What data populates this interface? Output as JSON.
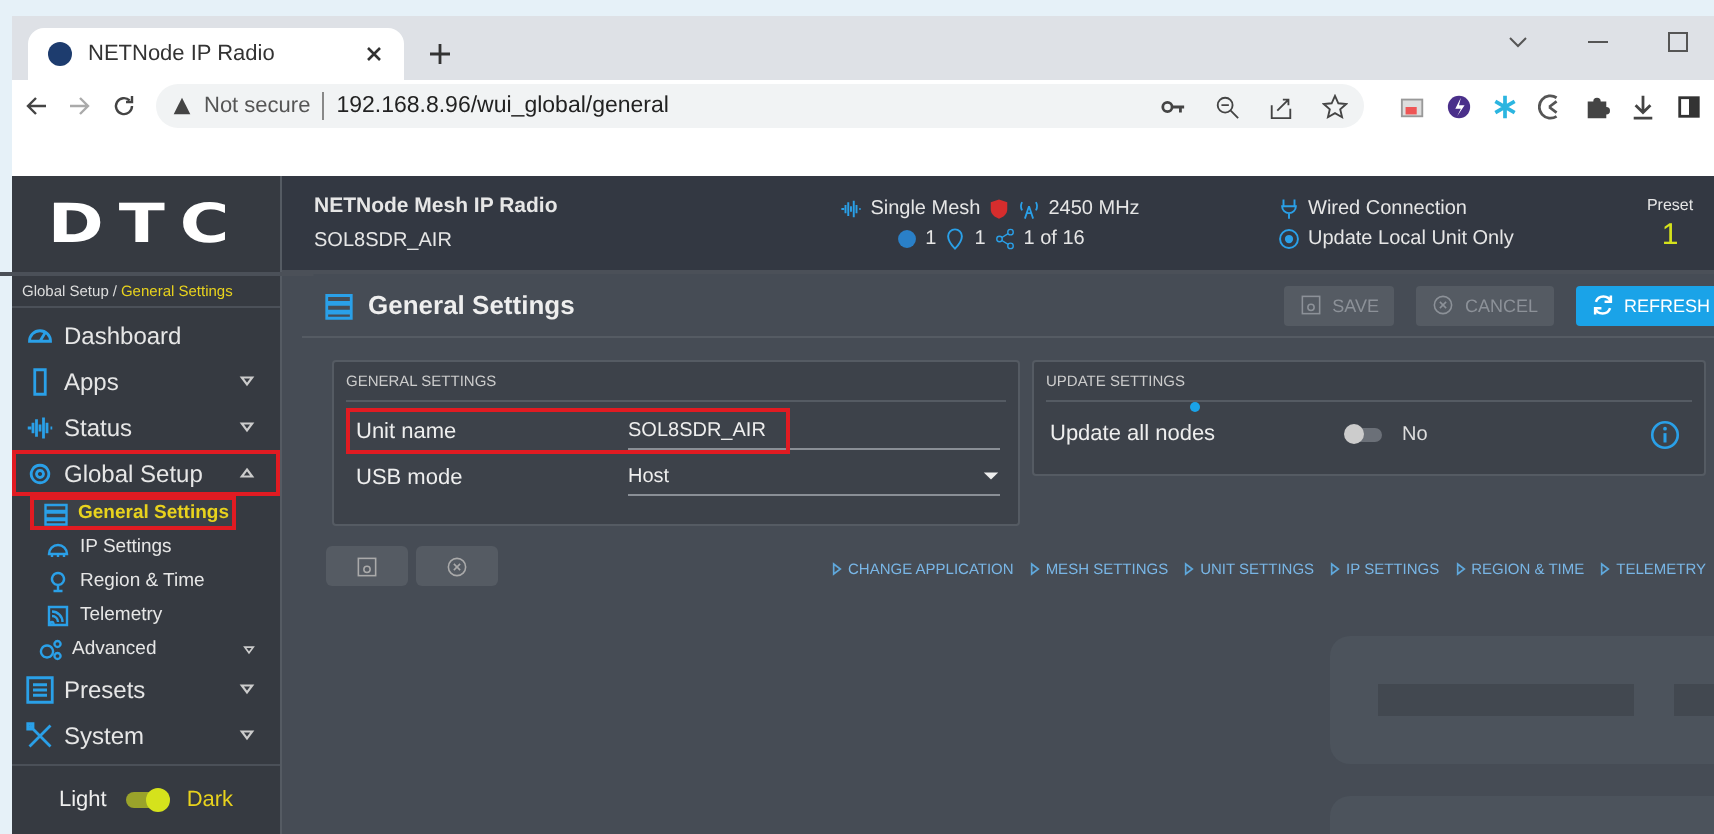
{
  "browser": {
    "tab_title": "NETNode IP Radio",
    "security": "Not secure",
    "url": "192.168.8.96/wui_global/general"
  },
  "header": {
    "logo": "DTC",
    "device_title": "NETNode Mesh IP Radio",
    "device_name": "SOL8SDR_AIR",
    "mesh_mode": "Single Mesh",
    "frequency": "2450 MHz",
    "nodes": "1",
    "locations": "1",
    "links": "1 of 16",
    "connection": "Wired Connection",
    "update_mode": "Update Local Unit Only",
    "preset_label": "Preset",
    "preset_value": "1"
  },
  "breadcrumb": {
    "separator": "/",
    "items": [
      {
        "label": "Global Setup",
        "selected": false
      },
      {
        "label": "General Settings",
        "selected": true
      }
    ]
  },
  "sidebar": {
    "items": [
      {
        "kind": "link",
        "label": "Dashboard",
        "highlighted": false
      },
      {
        "kind": "main",
        "label": "Apps",
        "expanded": false,
        "highlighted": false
      },
      {
        "kind": "main",
        "label": "Status",
        "expanded": false,
        "highlighted": false
      },
      {
        "kind": "main",
        "label": "Global Setup",
        "expanded": true,
        "highlighted": true,
        "children": [
          {
            "kind": "sub",
            "label": "General Settings",
            "selected": true,
            "highlighted": true
          },
          {
            "kind": "sub",
            "label": "IP Settings",
            "selected": false,
            "highlighted": false
          },
          {
            "kind": "sub",
            "label": "Region & Time",
            "selected": false,
            "highlighted": false
          },
          {
            "kind": "sub",
            "label": "Telemetry",
            "selected": false,
            "highlighted": false
          },
          {
            "kind": "group",
            "label": "Advanced",
            "expanded": false,
            "highlighted": false
          }
        ]
      },
      {
        "kind": "main",
        "label": "Presets",
        "expanded": false,
        "highlighted": false
      },
      {
        "kind": "main",
        "label": "System",
        "expanded": false,
        "highlighted": false
      }
    ]
  },
  "theme": {
    "light": "Light",
    "dark": "Dark",
    "on": true
  },
  "page": {
    "title": "General Settings",
    "actions": [
      {
        "kind": "save",
        "label": "SAVE",
        "disabled": true
      },
      {
        "kind": "cancel",
        "label": "CANCEL",
        "disabled": true
      },
      {
        "kind": "refresh",
        "label": "REFRESH",
        "disabled": false
      }
    ]
  },
  "general_settings": {
    "title": "GENERAL SETTINGS",
    "fields": [
      {
        "kind": "text",
        "label": "Unit name",
        "value": "SOL8SDR_AIR",
        "highlighted": true
      },
      {
        "kind": "select",
        "label": "USB mode",
        "value": "Host",
        "highlighted": false
      }
    ]
  },
  "update_settings": {
    "title": "UPDATE SETTINGS",
    "label": "Update all nodes",
    "changed": true,
    "on": false,
    "state": "No"
  },
  "links": [
    "CHANGE APPLICATION",
    "MESH SETTINGS",
    "UNIT SETTINGS",
    "IP SETTINGS",
    "REGION & TIME",
    "TELEMETRY"
  ]
}
